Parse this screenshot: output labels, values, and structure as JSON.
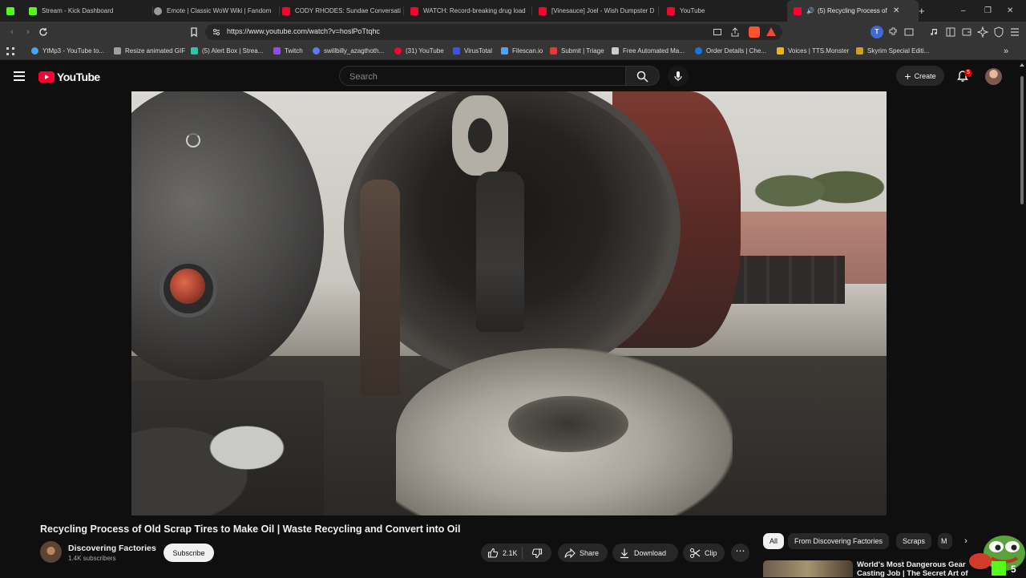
{
  "browser": {
    "tabs": [
      {
        "title": "",
        "favicon_color": "#53fc18",
        "icon": "kick-glyph-icon"
      },
      {
        "title": "Stream - Kick Dashboard",
        "favicon_color": "#53fc18"
      },
      {
        "title": "Emote | Classic WoW Wiki | Fandom",
        "favicon_color": "#9a9a9a"
      },
      {
        "title": "CODY RHODES: Sundae Conversati",
        "favicon_color": "#ff0033"
      },
      {
        "title": "WATCH: Record-breaking drug load",
        "favicon_color": "#ff0033"
      },
      {
        "title": "[Vinesauce] Joel - Wish Dumpster D",
        "favicon_color": "#ff0033"
      },
      {
        "title": "YouTube",
        "favicon_color": "#ff0033"
      },
      {
        "title": "(5) Recycling Process of Old",
        "favicon_color": "#ff0033",
        "active": true
      }
    ],
    "new_tab": "+",
    "window_controls": [
      "–",
      "❐",
      "✕"
    ],
    "url": "https://www.youtube.com/watch?v=hoslPoTtqhc",
    "bookmarks": [
      {
        "label": "YtMp3 - YouTube to...",
        "color": "#3ea6ff"
      },
      {
        "label": "Resize animated GIF",
        "color": "#9aa0a6"
      },
      {
        "label": "(5) Alert Box | Strea...",
        "color": "#31c3a2"
      },
      {
        "label": "Twitch",
        "color": "#9146ff"
      },
      {
        "label": "swillbilly_azagthoth...",
        "color": "#5b7cfa"
      },
      {
        "label": "(31) YouTube",
        "color": "#ff0033"
      },
      {
        "label": "VirusTotal",
        "color": "#394eff"
      },
      {
        "label": "Filescan.io",
        "color": "#4aa3ff"
      },
      {
        "label": "Submit | Triage",
        "color": "#e53935"
      },
      {
        "label": "Free Automated Ma...",
        "color": "#cccccc"
      },
      {
        "label": "Order Details | Che...",
        "color": "#1a73e8"
      },
      {
        "label": "Voices | TTS.Monster",
        "color": "#f4b400"
      },
      {
        "label": "Skyrim Special Editi...",
        "color": "#c9a227"
      }
    ],
    "bookmarks_overflow": "»"
  },
  "youtube": {
    "logo_text": "YouTube",
    "brand_color": "#ff0033",
    "search_placeholder": "Search",
    "create_label": "Create",
    "notification_count": "5"
  },
  "video": {
    "title": "Recycling Process of Old Scrap Tires to Make Oil | Waste Recycling and Convert into Oil",
    "channel": "Discovering Factories",
    "subscribers": "1.4K subscribers",
    "subscribe_label": "Subscribe",
    "likes": "2.1K",
    "share_label": "Share",
    "download_label": "Download",
    "clip_label": "Clip",
    "more_label": "⋯"
  },
  "chips": [
    {
      "label": "All",
      "active": true
    },
    {
      "label": "From Discovering Factories"
    },
    {
      "label": "Scraps"
    },
    {
      "label": "M"
    }
  ],
  "recommendation": {
    "title": "World's Most Dangerous Gear Casting Job | The Secret Art of"
  },
  "overlay": {
    "badge": "5"
  }
}
